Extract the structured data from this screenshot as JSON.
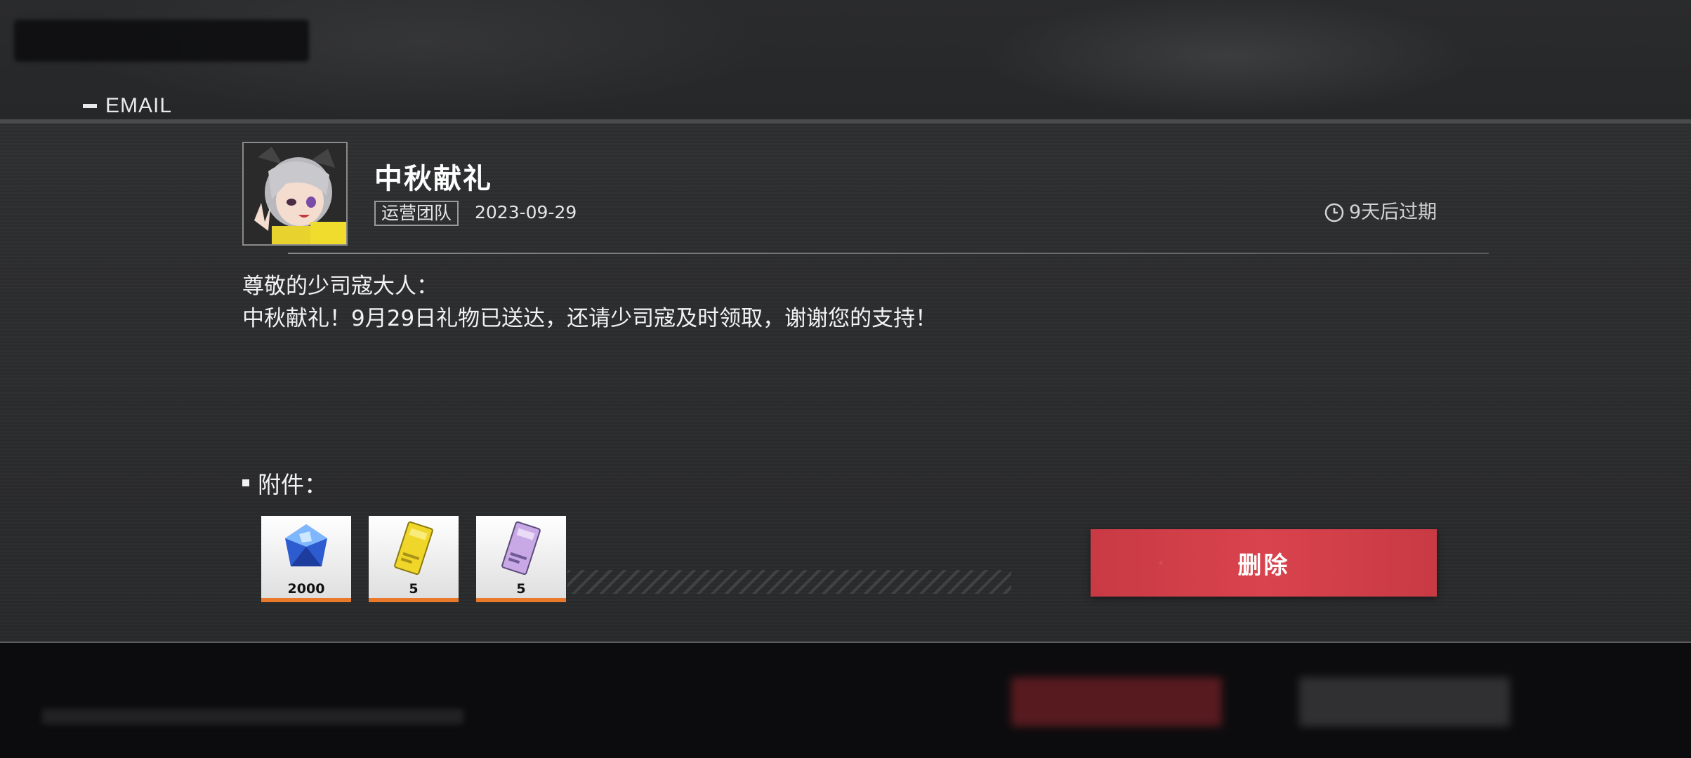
{
  "header": {
    "label": "EMAIL"
  },
  "mail": {
    "title": "中秋献礼",
    "sender": "运营团队",
    "date": "2023-09-29",
    "expiry": "9天后过期",
    "greeting": "尊敬的少司寇大人：",
    "content": "中秋献礼！9月29日礼物已送达，还请少司寇及时领取，谢谢您的支持！"
  },
  "attachments": {
    "label": "附件：",
    "items": [
      {
        "icon": "crystal-icon",
        "count": "2000"
      },
      {
        "icon": "yellow-ticket-icon",
        "count": "5"
      },
      {
        "icon": "purple-ticket-icon",
        "count": "5"
      }
    ]
  },
  "actions": {
    "delete_label": "删除"
  },
  "colors": {
    "accent_red": "#d9434d",
    "item_border": "#e97a2c"
  }
}
